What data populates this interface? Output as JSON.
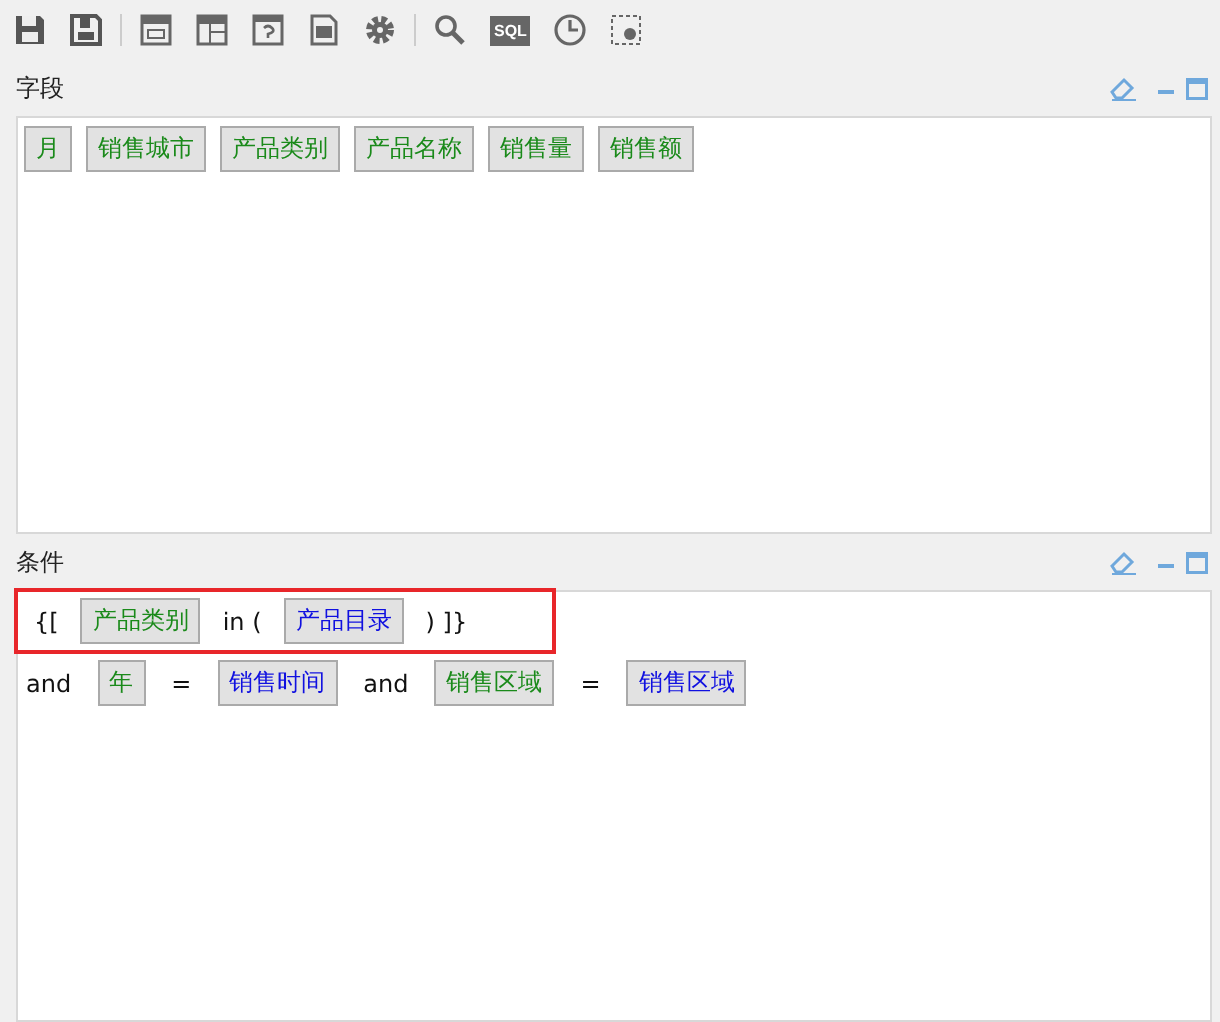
{
  "toolbar": [
    {
      "kind": "save"
    },
    {
      "kind": "save-as"
    },
    {
      "kind": "sep"
    },
    {
      "kind": "layout"
    },
    {
      "kind": "table"
    },
    {
      "kind": "help"
    },
    {
      "kind": "doc"
    },
    {
      "kind": "gear"
    },
    {
      "kind": "sep"
    },
    {
      "kind": "search"
    },
    {
      "kind": "sql",
      "label": "SQL"
    },
    {
      "kind": "clock"
    },
    {
      "kind": "frame"
    }
  ],
  "fields_panel": {
    "title": "字段",
    "tokens": [
      {
        "kind": "field",
        "text": "月"
      },
      {
        "kind": "field",
        "text": "销售城市"
      },
      {
        "kind": "field",
        "text": "产品类别"
      },
      {
        "kind": "field",
        "text": "产品名称"
      },
      {
        "kind": "field",
        "text": "销售量"
      },
      {
        "kind": "field",
        "text": "销售额"
      }
    ]
  },
  "conditions_panel": {
    "title": "条件",
    "lines": [
      {
        "highlighted": true,
        "tokens": [
          {
            "kind": "text",
            "text": "{["
          },
          {
            "kind": "field",
            "text": "产品类别"
          },
          {
            "kind": "text",
            "text": "in ("
          },
          {
            "kind": "param",
            "text": "产品目录"
          },
          {
            "kind": "text",
            "text": ") ]}"
          }
        ]
      },
      {
        "highlighted": false,
        "tokens": [
          {
            "kind": "text",
            "text": "and"
          },
          {
            "kind": "field",
            "text": "年"
          },
          {
            "kind": "text",
            "text": "="
          },
          {
            "kind": "param",
            "text": "销售时间"
          },
          {
            "kind": "text",
            "text": "and"
          },
          {
            "kind": "field",
            "text": "销售区域"
          },
          {
            "kind": "text",
            "text": "="
          },
          {
            "kind": "param",
            "text": "销售区域"
          }
        ]
      }
    ]
  }
}
